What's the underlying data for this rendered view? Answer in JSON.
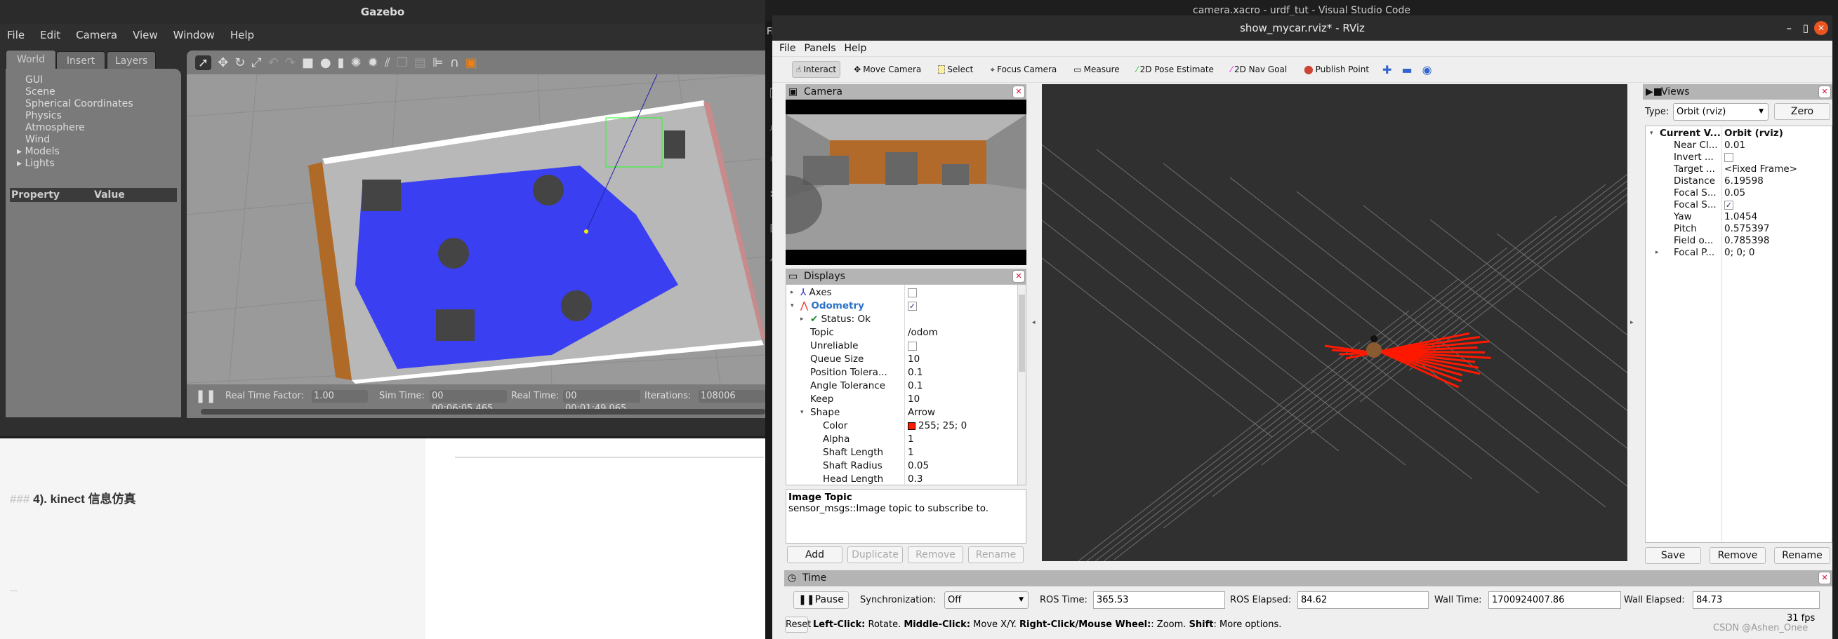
{
  "gazebo": {
    "title": "Gazebo",
    "menu": [
      "File",
      "Edit",
      "Camera",
      "View",
      "Window",
      "Help"
    ],
    "tabs": [
      "World",
      "Insert",
      "Layers"
    ],
    "world_items": [
      "GUI",
      "Scene",
      "Spherical Coordinates",
      "Physics",
      "Atmosphere",
      "Wind",
      "Models",
      "Lights"
    ],
    "property_header": "Property",
    "value_header": "Value",
    "bottom": {
      "rtf_label": "Real Time Factor:",
      "rtf": "1.00",
      "sim_label": "Sim Time:",
      "sim": "00 00:06:05.465",
      "real_label": "Real Time:",
      "real": "00 00:01:49.065",
      "iter_label": "Iterations:",
      "iter": "108006"
    }
  },
  "document": {
    "heading_marker": "###",
    "heading": "4). kinect 信息仿真",
    "rule": "---"
  },
  "vscode": {
    "title": "camera.xacro - urdf_tut - Visual Studio Code",
    "menu_file": "File"
  },
  "rviz": {
    "title": "show_mycar.rviz* - RViz",
    "menu": [
      "File",
      "Panels",
      "Help"
    ],
    "toolbar": [
      "Interact",
      "Move Camera",
      "Select",
      "Focus Camera",
      "Measure",
      "2D Pose Estimate",
      "2D Nav Goal",
      "Publish Point"
    ],
    "camera_panel": "Camera",
    "displays_panel": "Displays",
    "displays": [
      {
        "name": "Axes",
        "value": "",
        "checkbox": false,
        "level": 0,
        "arrow": "right"
      },
      {
        "name": "Odometry",
        "value": "",
        "checkbox": true,
        "level": 0,
        "arrow": "down"
      },
      {
        "name": "Status: Ok",
        "value": "",
        "level": 1,
        "arrow": "right"
      },
      {
        "name": "Topic",
        "value": "/odom",
        "level": 1
      },
      {
        "name": "Unreliable",
        "value": "",
        "checkbox": false,
        "level": 1
      },
      {
        "name": "Queue Size",
        "value": "10",
        "level": 1
      },
      {
        "name": "Position Tolera...",
        "value": "0.1",
        "level": 1
      },
      {
        "name": "Angle Tolerance",
        "value": "0.1",
        "level": 1
      },
      {
        "name": "Keep",
        "value": "10",
        "level": 1
      },
      {
        "name": "Shape",
        "value": "Arrow",
        "level": 1,
        "arrow": "down"
      },
      {
        "name": "Color",
        "value": "255; 25; 0",
        "level": 2,
        "swatch": "#ff1900"
      },
      {
        "name": "Alpha",
        "value": "1",
        "level": 2
      },
      {
        "name": "Shaft Length",
        "value": "1",
        "level": 2
      },
      {
        "name": "Shaft Radius",
        "value": "0.05",
        "level": 2
      },
      {
        "name": "Head Length",
        "value": "0.3",
        "level": 2
      }
    ],
    "description": {
      "title": "Image Topic",
      "text": "sensor_msgs::Image topic to subscribe to."
    },
    "display_buttons": [
      "Add",
      "Duplicate",
      "Remove",
      "Rename"
    ],
    "views_panel": "Views",
    "views": {
      "type_label": "Type:",
      "type": "Orbit (rviz)",
      "zero": "Zero",
      "rows": [
        {
          "name": "Current V...",
          "value": "Orbit (rviz)"
        },
        {
          "name": "Near Cl...",
          "value": "0.01"
        },
        {
          "name": "Invert ...",
          "value": "",
          "checkbox": false
        },
        {
          "name": "Target ...",
          "value": "<Fixed Frame>"
        },
        {
          "name": "Distance",
          "value": "6.19598"
        },
        {
          "name": "Focal S...",
          "value": "0.05"
        },
        {
          "name": "Focal S...",
          "value": "",
          "checkbox": true
        },
        {
          "name": "Yaw",
          "value": "1.0454"
        },
        {
          "name": "Pitch",
          "value": "0.575397"
        },
        {
          "name": "Field o...",
          "value": "0.785398"
        },
        {
          "name": "Focal P...",
          "value": "0; 0; 0"
        }
      ],
      "buttons": [
        "Save",
        "Remove",
        "Rename"
      ]
    },
    "time_panel": "Time",
    "time": {
      "pause": "Pause",
      "sync_label": "Synchronization:",
      "sync": "Off",
      "ros_time_label": "ROS Time:",
      "ros_time": "365.53",
      "ros_elapsed_label": "ROS Elapsed:",
      "ros_elapsed": "84.62",
      "wall_time_label": "Wall Time:",
      "wall_time": "1700924007.86",
      "wall_elapsed_label": "Wall Elapsed:",
      "wall_elapsed": "84.73"
    },
    "status": {
      "reset": "Reset",
      "k1": "Left-Click:",
      "t1": " Rotate. ",
      "k2": "Middle-Click:",
      "t2": " Move X/Y. ",
      "k3": "Right-Click/Mouse Wheel:",
      "t3": ": Zoom. ",
      "k4": "Shift",
      "t4": ": More options.",
      "fps": "31 fps"
    },
    "watermark": "CSDN @Ashen_Onee",
    "arrow_color": "#ff1900"
  }
}
